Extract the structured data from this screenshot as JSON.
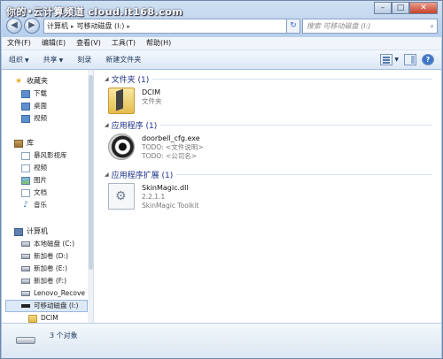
{
  "watermark": "你的•云计算频道 cloud.it168.com",
  "caption": {
    "minimize": "–",
    "maximize": "□",
    "close": "✕"
  },
  "address": {
    "segments": [
      "计算机",
      "可移动磁盘 (I:)"
    ],
    "search_placeholder": "搜索 可移动磁盘 (I:)"
  },
  "menu": {
    "file": "文件(F)",
    "edit": "编辑(E)",
    "view": "查看(V)",
    "tools": "工具(T)",
    "help": "帮助(H)"
  },
  "toolbar": {
    "organize": "组织",
    "share": "共享",
    "burn": "刻录",
    "new_folder": "新建文件夹"
  },
  "nav": {
    "favorites": "收藏夹",
    "downloads": "下载",
    "desktop": "桌面",
    "videos_fav": "视频",
    "libraries": "库",
    "storm": "暴风影视库",
    "videos": "视频",
    "pictures": "图片",
    "documents": "文档",
    "music": "音乐",
    "computer": "计算机",
    "drive_c": "本地磁盘 (C:)",
    "drive_d": "新加卷 (D:)",
    "drive_e": "新加卷 (E:)",
    "drive_f": "新加卷 (F:)",
    "lenovo": "Lenovo_Recove",
    "drive_i": "可移动磁盘 (I:)",
    "dcim": "DCIM"
  },
  "groups": {
    "folders": "文件夹 (1)",
    "apps": "应用程序 (1)",
    "extensions": "应用程序扩展 (1)"
  },
  "files": {
    "dcim": {
      "name": "DCIM",
      "line1": "文件夹"
    },
    "app": {
      "name": "doorbell_cfg.exe",
      "line1": "TODO: <文件说明>",
      "line2": "TODO: <公司名>"
    },
    "dll": {
      "name": "SkinMagic.dll",
      "line1": "2.2.1.1",
      "line2": "SkinMagic Toolkit"
    }
  },
  "status": {
    "count": "3 个对象"
  }
}
